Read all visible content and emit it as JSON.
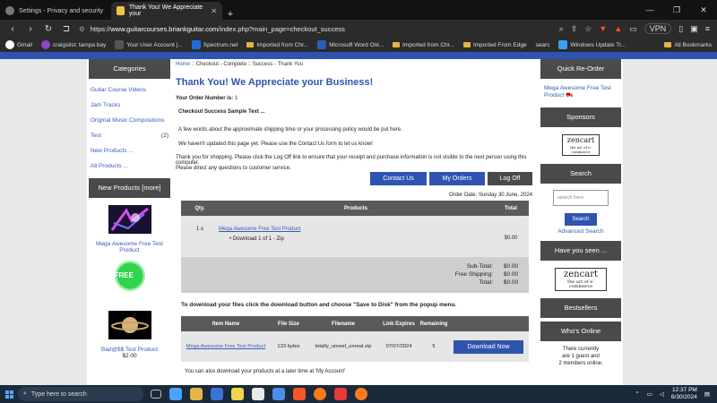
{
  "browser": {
    "tabs": [
      {
        "title": "Settings - Privacy and security",
        "active": false
      },
      {
        "title": "Thank You! We Appreciate your",
        "active": true
      }
    ],
    "url_prefix": "https://",
    "url_host": "www.guitarcourses.briankguitar.com",
    "url_path": "/index.php?main_page=checkout_success",
    "vpn": "VPN",
    "bookmarks": [
      "Gmail",
      "craigslist: tampa bay",
      "Your User Account |...",
      "Spectrum.net",
      "Imported from Chr...",
      "Microsoft Word Onl...",
      "Imported from Chr...",
      "Imported From Edge",
      "searc",
      "Windows Update Tr..."
    ],
    "all_bookmarks": "All Bookmarks"
  },
  "left": {
    "categories_title": "Categories",
    "categories": [
      {
        "label": "Guitar Course Videos",
        "count": ""
      },
      {
        "label": "Jam Tracks",
        "count": ""
      },
      {
        "label": "Original Music Compositions",
        "count": ""
      },
      {
        "label": "Test",
        "count": "(2)"
      },
      {
        "label": "New Products ...",
        "count": ""
      },
      {
        "label": "All Products ...",
        "count": ""
      }
    ],
    "new_products_title": "New Products  [more]",
    "products": [
      {
        "name": "Mega Awesome Free Test Product",
        "price": ""
      },
      {
        "name": "",
        "badge": "FREE"
      },
      {
        "name": "Bad@$$ Test Product",
        "price": "$2.00"
      }
    ]
  },
  "main": {
    "breadcrumb": {
      "home": "Home",
      "sep": " :: ",
      "step1": "Checkout - Complete",
      "step2": "Success - Thank You"
    },
    "title": "Thank You! We Appreciate your Business!",
    "order_number_label": "Your Order Number is:",
    "order_number": "1",
    "sample_heading": "Checkout Success Sample Text ...",
    "shipping_text": "A few words about the approximate shipping time or your processing policy would be put here.",
    "update_text": "We haven't updated this page yet. Please use the Contact Us form to let us know!",
    "logoff_text": "Thank you for shopping. Please click the Log Off link to ensure that your receipt and purchase information is not visible to the next person using this computer.",
    "questions_text": "Please direct any questions to customer service.",
    "buttons": {
      "contact": "Contact Us",
      "orders": "My Orders",
      "logoff": "Log Off"
    },
    "order_date": "Order Date: Sunday 30 June, 2024",
    "order_table": {
      "headers": [
        "Qty.",
        "Products",
        "Total"
      ],
      "rows": [
        {
          "qty": "1 x",
          "product": "Mega Awesome Free Test Product",
          "sub": "Download 1 of 1 - Zip",
          "total": "$0.00"
        }
      ],
      "summary": [
        {
          "label": "Sub-Total:",
          "value": "$0.00"
        },
        {
          "label": "Free Shipping:",
          "value": "$0.00"
        },
        {
          "label": "Total:",
          "value": "$0.00"
        }
      ]
    },
    "download_heading": "To download your files click the download button and choose \"Save to Disk\" from the popup menu.",
    "download_table": {
      "headers": [
        "Item Name",
        "File Size",
        "Filename",
        "Link Expires",
        "Remaining"
      ],
      "row": {
        "name": "Mega Awesome Free Test Product",
        "size": "133 bytes",
        "filename": "totally_unreel_unreal.zip",
        "expires": "07/07/2024",
        "remaining": "5",
        "button": "Download Now"
      }
    },
    "footer_text": "You can also download your products at a later time at 'My Account'"
  },
  "right": {
    "quick_reorder_title": "Quick Re-Order",
    "quick_item": "Mega Awesome Free Test Product",
    "sponsors_title": "Sponsors",
    "logo_main": "zencart",
    "logo_sub": "the art of e-commerce",
    "search_title": "Search",
    "search_placeholder": "search here",
    "search_button": "Search",
    "advanced_search": "Advanced Search",
    "have_seen_title": "Have you seen ...",
    "bestsellers_title": "Bestsellers",
    "whos_online_title": "Who's Online",
    "whos_online_text": [
      "There currently",
      "are 1 guest and",
      "2 members online."
    ]
  },
  "taskbar": {
    "search_placeholder": "Type here to search",
    "time": "12:37 PM",
    "date": "6/30/2024"
  },
  "colors": {
    "accent": "#2f54b0",
    "sidebar_header": "#4a4a4a",
    "link": "#3b5cb8"
  }
}
